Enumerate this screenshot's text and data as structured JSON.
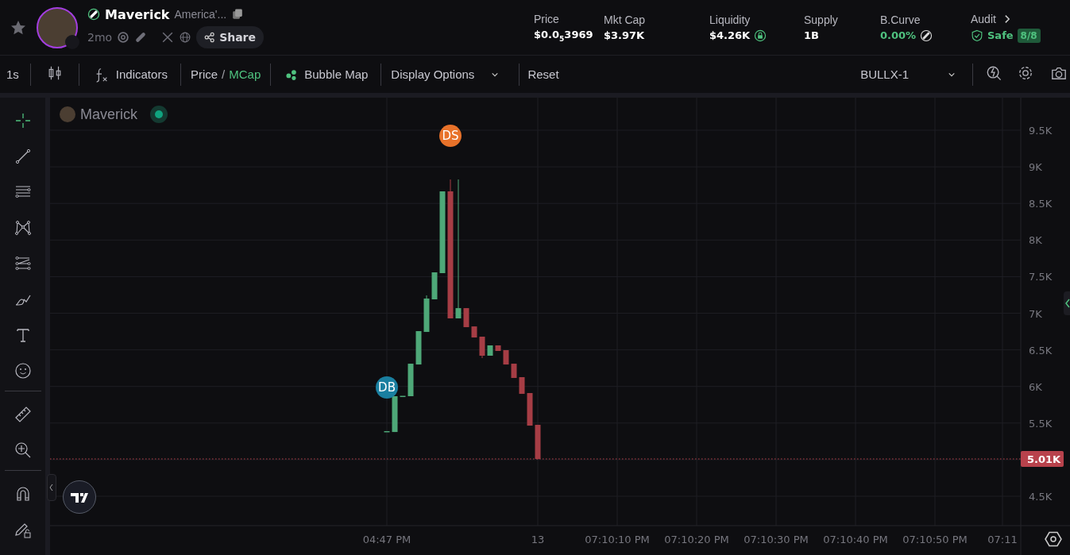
{
  "token": {
    "name": "Maverick",
    "subtitle": "America'...",
    "age": "2mo",
    "share_label": "Share"
  },
  "stats": [
    {
      "kind": "plain",
      "label": "Price",
      "value": "$0.0$_{5}$3969"
    },
    {
      "kind": "plain",
      "label": "Mkt Cap",
      "value": "$3.97K"
    },
    {
      "kind": "lock",
      "label": "Liquidity",
      "value": "$4.26K"
    },
    {
      "kind": "plain",
      "label": "Supply",
      "value": "1B"
    },
    {
      "kind": "curve",
      "label": "B.Curve",
      "value": "0.00%"
    },
    {
      "kind": "audit",
      "label": "Audit",
      "value": "Safe",
      "badge": "8/8"
    }
  ],
  "toolbar": {
    "interval": "1s",
    "indicators": "Indicators",
    "price_toggle": [
      {
        "label": "Price",
        "selected": false
      },
      {
        "label": "MCap",
        "selected": true
      }
    ],
    "toggle_separator": "/",
    "bubble_map": "Bubble Map",
    "display_options": "Display Options",
    "reset": "Reset",
    "layout": "BULLX-1"
  },
  "tool_groups": [
    [
      {
        "selected": true
      },
      {
        "selected": false
      },
      {
        "selected": false
      },
      {
        "selected": false
      },
      {
        "selected": false
      },
      {
        "selected": false
      },
      {
        "selected": false
      },
      {
        "selected": false
      }
    ],
    [
      {
        "selected": false
      },
      {
        "selected": false
      }
    ],
    [
      {
        "selected": false
      },
      {
        "selected": false
      }
    ]
  ],
  "legend": {
    "name": "Maverick"
  },
  "chart": {
    "price_labels": [
      "9.5K",
      "9K",
      "8.5K",
      "8K",
      "7.5K",
      "7K",
      "6.5K",
      "6K",
      "5.5K",
      "4.5K"
    ],
    "time_labels": [
      "04:47 PM",
      "13",
      "07:10:10 PM",
      "07:10:20 PM",
      "07:10:30 PM",
      "07:10:40 PM",
      "07:10:50 PM",
      "07:11"
    ],
    "markers": [
      {
        "label": "DS",
        "color": "#e8722a"
      },
      {
        "label": "DB",
        "color": "#1a7fa0"
      }
    ],
    "price_tag": "5.01K"
  }
}
